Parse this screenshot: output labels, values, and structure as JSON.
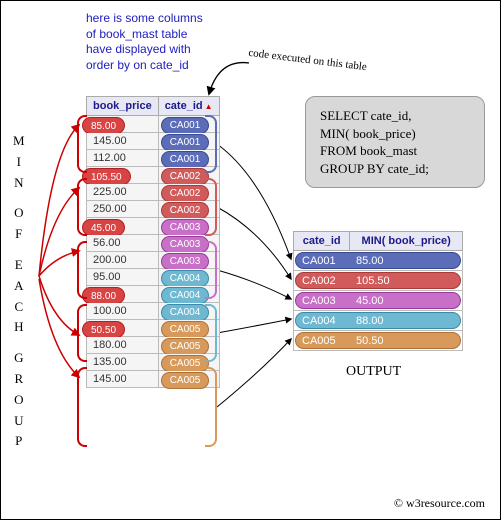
{
  "caption": {
    "l1": "here is some columns",
    "l2": "of book_mast table",
    "l3": "have displayed with",
    "l4": "order by on cate_id"
  },
  "vertical": {
    "w1": "MIN",
    "w2": "OF",
    "w3": "EACH",
    "w4": "GROUP"
  },
  "source": {
    "headers": {
      "price": "book_price",
      "cate": "cate_id"
    },
    "rows": [
      {
        "price": "85.00",
        "cate": "CA001",
        "grp": "grp1",
        "min": true
      },
      {
        "price": "145.00",
        "cate": "CA001",
        "grp": "grp1"
      },
      {
        "price": "112.00",
        "cate": "CA001",
        "grp": "grp1"
      },
      {
        "price": "105.50",
        "cate": "CA002",
        "grp": "grp2",
        "min": true
      },
      {
        "price": "225.00",
        "cate": "CA002",
        "grp": "grp2"
      },
      {
        "price": "250.00",
        "cate": "CA002",
        "grp": "grp2"
      },
      {
        "price": "45.00",
        "cate": "CA003",
        "grp": "grp3",
        "min": true
      },
      {
        "price": "56.00",
        "cate": "CA003",
        "grp": "grp3"
      },
      {
        "price": "200.00",
        "cate": "CA003",
        "grp": "grp3"
      },
      {
        "price": "95.00",
        "cate": "CA004",
        "grp": "grp4"
      },
      {
        "price": "88.00",
        "cate": "CA004",
        "grp": "grp4",
        "min": true
      },
      {
        "price": "100.00",
        "cate": "CA004",
        "grp": "grp4"
      },
      {
        "price": "50.50",
        "cate": "CA005",
        "grp": "grp5",
        "min": true
      },
      {
        "price": "180.00",
        "cate": "CA005",
        "grp": "grp5"
      },
      {
        "price": "135.00",
        "cate": "CA005",
        "grp": "grp5"
      },
      {
        "price": "145.00",
        "cate": "CA005",
        "grp": "grp5"
      }
    ]
  },
  "sql": {
    "l1": "SELECT cate_id,",
    "l2": "MIN( book_price)",
    "l3": "FROM book_mast",
    "l4": "GROUP BY cate_id;"
  },
  "code_label": "code executed on this table",
  "output": {
    "headers": {
      "cate": "cate_id",
      "min": "MIN( book_price)"
    },
    "rows": [
      {
        "cate": "CA001",
        "min": "85.00",
        "grp": "grp1"
      },
      {
        "cate": "CA002",
        "min": "105.50",
        "grp": "grp2"
      },
      {
        "cate": "CA003",
        "min": "45.00",
        "grp": "grp3"
      },
      {
        "cate": "CA004",
        "min": "88.00",
        "grp": "grp4"
      },
      {
        "cate": "CA005",
        "min": "50.50",
        "grp": "grp5"
      }
    ],
    "label": "OUTPUT"
  },
  "footer": "© w3resource.com"
}
